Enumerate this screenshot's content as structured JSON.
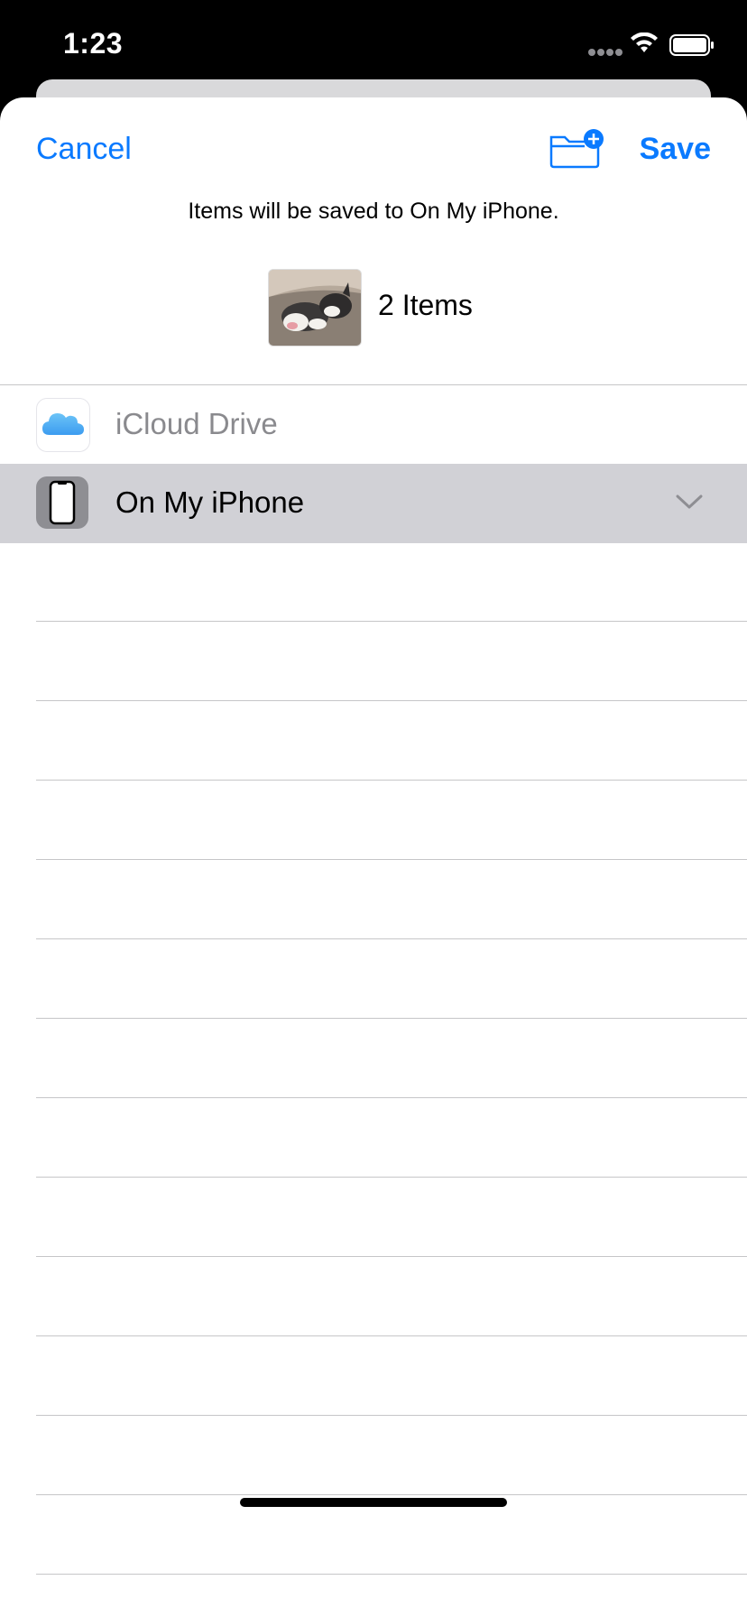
{
  "status_bar": {
    "time": "1:23"
  },
  "header": {
    "cancel_label": "Cancel",
    "save_label": "Save",
    "new_folder_icon": "folder-plus-icon"
  },
  "destination_note": "Items will be saved to On My iPhone.",
  "items_summary": {
    "count_label": "2 Items",
    "thumbnail": "kitten-photo"
  },
  "locations": [
    {
      "label": "iCloud Drive",
      "icon": "icloud-icon",
      "enabled": false
    },
    {
      "label": "On My iPhone",
      "icon": "iphone-icon",
      "selected": true,
      "expanded_indicator": "chevron-down-icon"
    }
  ],
  "colors": {
    "accent": "#0a7aff",
    "selected_row": "#d1d1d6",
    "disabled_text": "#8a8a8e"
  }
}
